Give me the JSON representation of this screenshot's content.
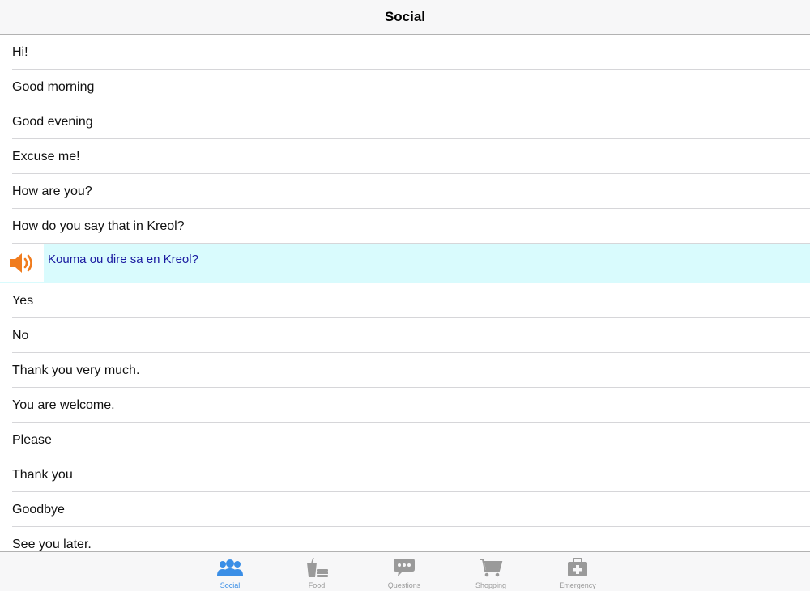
{
  "header": {
    "title": "Social"
  },
  "phrases": [
    "Hi!",
    "Good morning",
    "Good evening",
    "Excuse me!",
    "How are you?",
    "How do you say that in Kreol?"
  ],
  "expanded": {
    "translation": "Kouma ou dire sa en Kreol?",
    "icon": "speaker-icon"
  },
  "phrases_after": [
    "Yes",
    "No",
    "Thank you very much.",
    "You are welcome.",
    "Please",
    "Thank you",
    "Goodbye",
    "See you later."
  ],
  "tabs": [
    {
      "label": "Social",
      "icon": "people-icon"
    },
    {
      "label": "Food",
      "icon": "food-icon"
    },
    {
      "label": "Questions",
      "icon": "chat-bubble-icon"
    },
    {
      "label": "Shopping",
      "icon": "cart-icon"
    },
    {
      "label": "Emergency",
      "icon": "first-aid-kit-icon"
    }
  ],
  "colors": {
    "active_tab": "#3a8ee6",
    "inactive_tab": "#9a9a9a",
    "highlight_row": "#d9fbfd",
    "speaker": "#f07c1e"
  }
}
